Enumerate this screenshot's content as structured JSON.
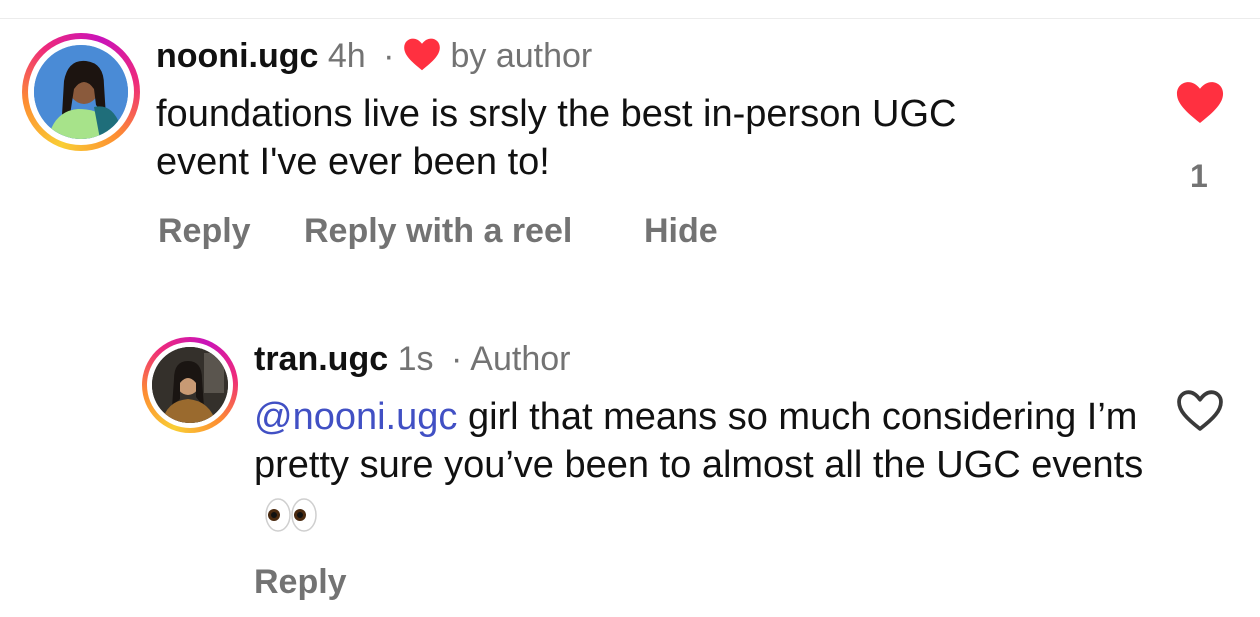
{
  "comments": [
    {
      "username": "nooni.ugc",
      "time": "4h",
      "separator": "·",
      "badge": "by author",
      "badge_icon": "heart-icon",
      "text": "foundations live is srsly the best in-person UGC event I've ever been to!",
      "actions": {
        "reply": "Reply",
        "reply_reel": "Reply with a reel",
        "hide": "Hide"
      },
      "liked": true,
      "like_count": "1"
    },
    {
      "username": "tran.ugc",
      "time": "1s",
      "separator": "·",
      "badge": "Author",
      "mention": "@nooni.ugc",
      "text": " girl that means so much considering I’m pretty sure you’ve been to almost all the UGC events",
      "emoji": "eyes-emoji",
      "actions": {
        "reply": "Reply"
      },
      "liked": false
    }
  ],
  "colors": {
    "like_red": "#ff3040",
    "mention_blue": "#4150c4",
    "secondary_text": "#737373"
  }
}
